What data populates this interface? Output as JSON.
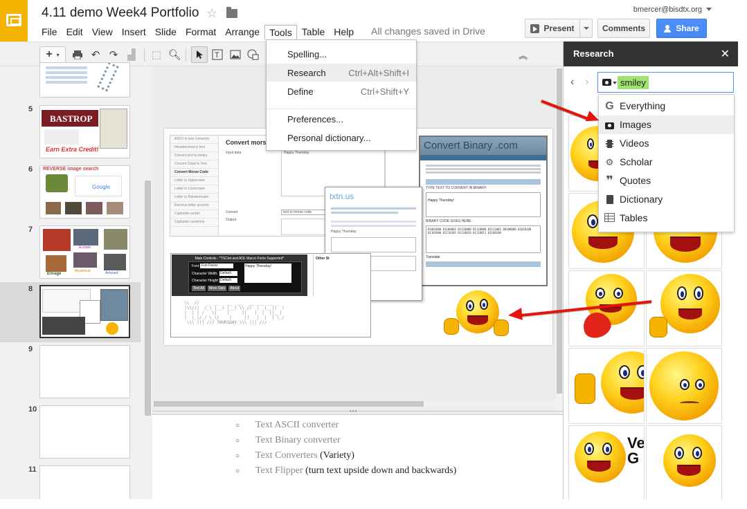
{
  "app": {
    "doc_title": "4.11 demo Week4 Portfolio",
    "save_status": "All changes saved in Drive",
    "user_email": "bmercer@bisdtx.org"
  },
  "menubar": [
    "File",
    "Edit",
    "View",
    "Insert",
    "Slide",
    "Format",
    "Arrange",
    "Tools",
    "Table",
    "Help"
  ],
  "buttons": {
    "present": "Present",
    "comments": "Comments",
    "share": "Share"
  },
  "tools_menu": {
    "items": [
      {
        "label": "Spelling...",
        "shortcut": ""
      },
      {
        "label": "Research",
        "shortcut": "Ctrl+Alt+Shift+I"
      },
      {
        "label": "Define",
        "shortcut": "Ctrl+Shift+Y"
      },
      {
        "label": "Preferences...",
        "shortcut": ""
      },
      {
        "label": "Personal dictionary...",
        "shortcut": ""
      }
    ],
    "highlighted": "Research"
  },
  "filmstrip": {
    "slide_numbers": [
      "5",
      "6",
      "7",
      "8",
      "9",
      "10",
      "11"
    ],
    "selected": "8",
    "thumb_texts": {
      "s5": "BASTROP",
      "s5_footer": "Earn Extra Credit!",
      "s6": "REVERSE image search",
      "s6_google": "Google",
      "s7_labels": [
        "Ecstatic",
        "Enrage",
        "Mysterical",
        "Amused"
      ]
    }
  },
  "slide8": {
    "morse_title": "Convert morse",
    "morse_input_label": "Input data",
    "morse_input_value": "Happy Thursday",
    "morse_convert_label": "Convert",
    "morse_output_label": "Output",
    "morse_select": "text to morse code",
    "morse_sidebar": [
      "ASCII to text converter",
      "Hexadecimal to text",
      "Convert text to binary",
      "Convert Octal to Text",
      "Convert Morse Code",
      "Letter to Uppercase",
      "Letter to Lowercase",
      "Letter to Randomcase",
      "Remove letter accents",
      "Capitalize words",
      "Capitalize sentence"
    ],
    "binary_title": "Convert Binary .com",
    "binary_type_label": "TYPE TEXT TO CONVERT IN BINARY:",
    "binary_input": "Happy Thursday!",
    "binary_output_label": "BINARY CODE GOES HERE:",
    "binary_translate": "Translate",
    "txtn_logo": "txtn.us",
    "txtn_label1": "Happy Thursday",
    "ascii_panel_title": "Main Controls - *TSCiet and AOL Macro Fonts Supported*",
    "ascii_font_label": "Font:",
    "ascii_font_value": "Fun Faces",
    "ascii_input": "Happy Thursday!",
    "ascii_width_label": "Character Width:",
    "ascii_height_label": "Character Height:",
    "ascii_default": "Default",
    "ascii_buttons": [
      "Test All",
      "More Opts",
      "About"
    ],
    "ascii_side_title": "Other St"
  },
  "notes": [
    {
      "text": "Text ASCII converter",
      "extra": ""
    },
    {
      "text": "Text Binary converter",
      "extra": ""
    },
    {
      "text": "Text Converters",
      "extra": " (Variety)"
    },
    {
      "text": "Text Flipper",
      "extra": " (turn text upside down and backwards)"
    }
  ],
  "research": {
    "title": "Research",
    "query": "smiley",
    "search_type": "Images",
    "types": [
      {
        "label": "Everything",
        "icon": "google-g-icon"
      },
      {
        "label": "Images",
        "icon": "camera-icon"
      },
      {
        "label": "Videos",
        "icon": "film-icon"
      },
      {
        "label": "Scholar",
        "icon": "scholar-icon"
      },
      {
        "label": "Quotes",
        "icon": "quote-icon"
      },
      {
        "label": "Dictionary",
        "icon": "book-icon"
      },
      {
        "label": "Tables",
        "icon": "table-icon"
      }
    ],
    "image_text": "Ver G"
  },
  "colors": {
    "accent_blue": "#4d90fe",
    "slides_yellow": "#f4b400",
    "arrow_red": "#e4150c",
    "search_highlight": "#9fe46f"
  }
}
